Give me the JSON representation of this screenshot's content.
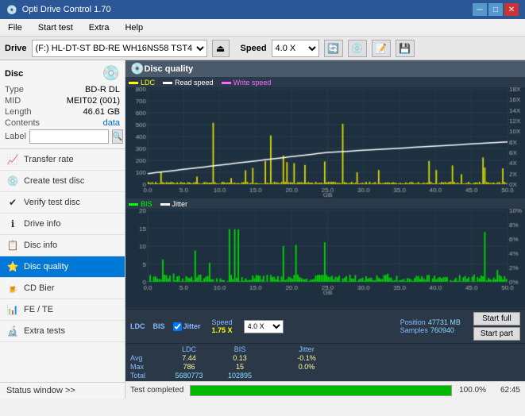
{
  "app": {
    "title": "Opti Drive Control 1.70",
    "icon": "💿"
  },
  "titlebar": {
    "title": "Opti Drive Control 1.70",
    "minimize_label": "─",
    "maximize_label": "□",
    "close_label": "✕"
  },
  "menubar": {
    "items": [
      "File",
      "Start test",
      "Extra",
      "Help"
    ]
  },
  "drivebar": {
    "drive_label": "Drive",
    "drive_value": "(F:)  HL-DT-ST BD-RE  WH16NS58 TST4",
    "speed_label": "Speed",
    "speed_value": "4.0 X"
  },
  "disc": {
    "title": "Disc",
    "type_label": "Type",
    "type_value": "BD-R DL",
    "mid_label": "MID",
    "mid_value": "MEIT02 (001)",
    "length_label": "Length",
    "length_value": "46.61 GB",
    "contents_label": "Contents",
    "contents_value": "data",
    "label_label": "Label",
    "label_value": ""
  },
  "nav": {
    "items": [
      {
        "id": "transfer-rate",
        "label": "Transfer rate",
        "icon": "📈"
      },
      {
        "id": "create-test-disc",
        "label": "Create test disc",
        "icon": "💿"
      },
      {
        "id": "verify-test-disc",
        "label": "Verify test disc",
        "icon": "✔"
      },
      {
        "id": "drive-info",
        "label": "Drive info",
        "icon": "ℹ"
      },
      {
        "id": "disc-info",
        "label": "Disc info",
        "icon": "📋"
      },
      {
        "id": "disc-quality",
        "label": "Disc quality",
        "icon": "⭐",
        "active": true
      },
      {
        "id": "cd-bier",
        "label": "CD Bier",
        "icon": "🍺"
      },
      {
        "id": "fe-te",
        "label": "FE / TE",
        "icon": "📊"
      },
      {
        "id": "extra-tests",
        "label": "Extra tests",
        "icon": "🔬"
      }
    ],
    "status_window": "Status window >>"
  },
  "chart1": {
    "title": "Disc quality",
    "legend": [
      {
        "label": "LDC",
        "color": "#ffff00"
      },
      {
        "label": "Read speed",
        "color": "#ffffff"
      },
      {
        "label": "Write speed",
        "color": "#ff66ff"
      }
    ],
    "y_max": 800,
    "y_right_max": 18,
    "x_max": 50
  },
  "chart2": {
    "legend": [
      {
        "label": "BIS",
        "color": "#00ff00"
      },
      {
        "label": "Jitter",
        "color": "#ffffff"
      }
    ],
    "y_max": 20,
    "y_right_max": 10,
    "x_max": 50
  },
  "stats": {
    "ldc_label": "LDC",
    "bis_label": "BIS",
    "jitter_label": "Jitter",
    "jitter_checked": true,
    "speed_label": "Speed",
    "speed_value": "1.75 X",
    "speed_select_value": "4.0 X",
    "position_label": "Position",
    "position_value": "47731 MB",
    "samples_label": "Samples",
    "samples_value": "760940",
    "avg_label": "Avg",
    "avg_ldc": "7.44",
    "avg_bis": "0.13",
    "avg_jitter": "-0.1%",
    "max_label": "Max",
    "max_ldc": "786",
    "max_bis": "15",
    "max_jitter": "0.0%",
    "total_label": "Total",
    "total_ldc": "5680773",
    "total_bis": "102895",
    "start_full_label": "Start full",
    "start_part_label": "Start part"
  },
  "progress": {
    "status_text": "Test completed",
    "percent": "100.0%",
    "time": "62:45"
  }
}
